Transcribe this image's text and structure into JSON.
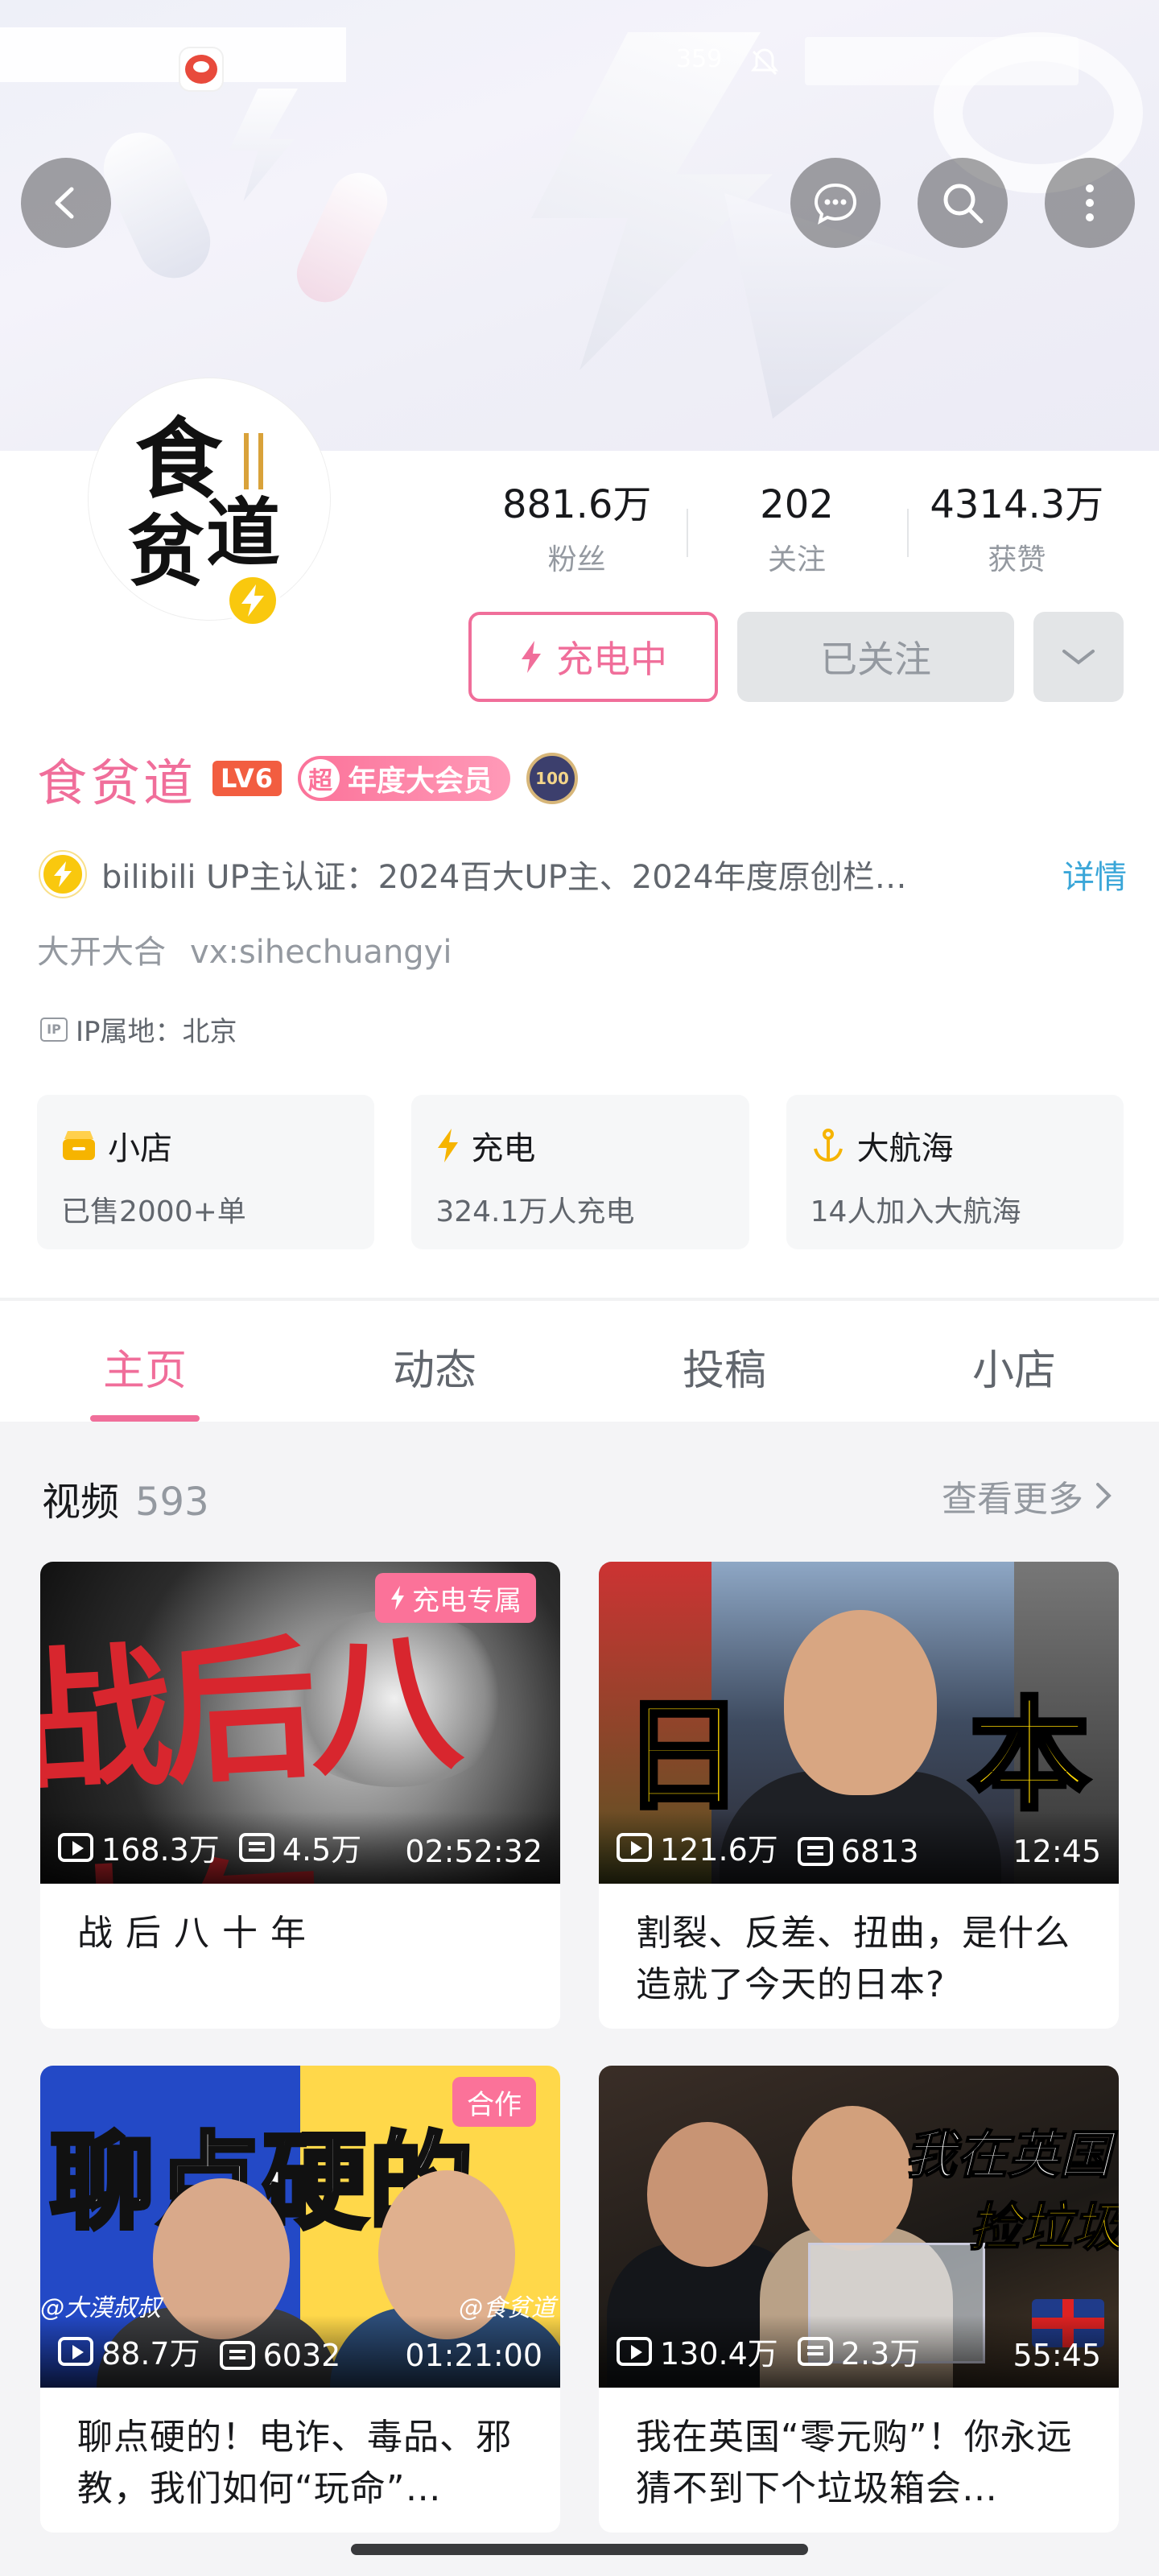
{
  "statusbar": {
    "num": "359"
  },
  "colors": {
    "accent": "#f06e9a",
    "vip": "#fb7299",
    "charge_yellow": "#f9c80e",
    "link": "#3aa6d8",
    "level": "#f25d40"
  },
  "icons": {
    "back": "chevron-left-icon",
    "message": "message-icon",
    "search": "search-icon",
    "more": "more-vertical-icon",
    "charge": "lightning-icon",
    "dropdown": "chevron-down-icon"
  },
  "avatar": {
    "text1": "食",
    "text2": "贫",
    "text3": "道"
  },
  "stats": [
    {
      "value": "881.6万",
      "label": "粉丝"
    },
    {
      "value": "202",
      "label": "关注"
    },
    {
      "value": "4314.3万",
      "label": "获赞"
    }
  ],
  "actions": {
    "charge": "充电中",
    "followed": "已关注"
  },
  "user": {
    "name": "食贫道",
    "level": "LV6",
    "vip_chao": "超",
    "vip": "年度大会员",
    "medal": "100"
  },
  "verify": {
    "text": "bilibili UP主认证：2024百大UP主、2024年度原创栏…",
    "more": "详情"
  },
  "bio": {
    "line1": "大开大合",
    "line2": "vx:sihechuangyi"
  },
  "ip": {
    "icon_text": "IP",
    "text": "IP属地：北京"
  },
  "cards": [
    {
      "title": "小店",
      "sub": "已售2000+单"
    },
    {
      "title": "充电",
      "sub": "324.1万人充电"
    },
    {
      "title": "大航海",
      "sub": "14人加入大航海"
    }
  ],
  "tabs": [
    "主页",
    "动态",
    "投稿",
    "小店"
  ],
  "videos_head": {
    "title": "视频",
    "count": "593",
    "more": "查看更多"
  },
  "videos": [
    {
      "title": "战 后 八 十 年",
      "views": "168.3万",
      "danmaku": "4.5万",
      "duration": "02:52:32",
      "tag": "充电专属",
      "thumb_text": "战后八十年"
    },
    {
      "title": "割裂、反差、扭曲，是什么造就了今天的日本?",
      "views": "121.6万",
      "danmaku": "6813",
      "duration": "12:45",
      "thumb_left": "日",
      "thumb_right": "本"
    },
    {
      "title": "聊点硬的！电诈、毒品、邪教，我们如何“玩命”…",
      "views": "88.7万",
      "danmaku": "6032",
      "duration": "01:21:00",
      "tag": "合作",
      "thumb_text": "聊点硬的",
      "handle_left": "@大漠叔叔",
      "handle_right": "@食贫道"
    },
    {
      "title": "我在英国“零元购”！你永远猜不到下个垃圾箱会…",
      "views": "130.4万",
      "danmaku": "2.3万",
      "duration": "55:45",
      "thumb_line1": "我在英国",
      "thumb_line2": "捡垃圾"
    }
  ]
}
